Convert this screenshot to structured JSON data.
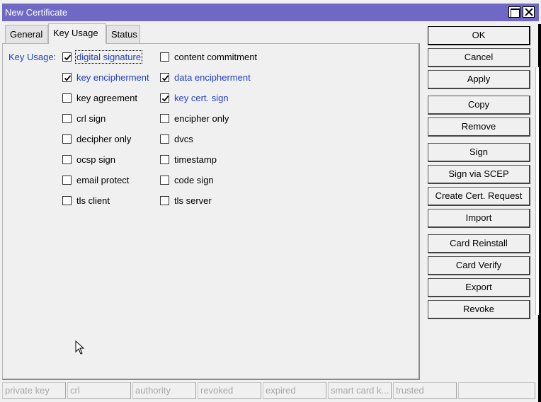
{
  "window": {
    "title": "New Certificate"
  },
  "tabs": [
    {
      "label": "General",
      "active": false
    },
    {
      "label": "Key Usage",
      "active": true
    },
    {
      "label": "Status",
      "active": false
    }
  ],
  "key_usage": {
    "label": "Key Usage:",
    "options": [
      {
        "label": "digital signature",
        "checked": true,
        "focused": true
      },
      {
        "label": "content commitment",
        "checked": false
      },
      {
        "label": "key encipherment",
        "checked": true
      },
      {
        "label": "data encipherment",
        "checked": true
      },
      {
        "label": "key agreement",
        "checked": false
      },
      {
        "label": "key cert. sign",
        "checked": true
      },
      {
        "label": "crl sign",
        "checked": false
      },
      {
        "label": "encipher only",
        "checked": false
      },
      {
        "label": "decipher only",
        "checked": false
      },
      {
        "label": "dvcs",
        "checked": false
      },
      {
        "label": "ocsp sign",
        "checked": false
      },
      {
        "label": "timestamp",
        "checked": false
      },
      {
        "label": "email protect",
        "checked": false
      },
      {
        "label": "code sign",
        "checked": false
      },
      {
        "label": "tls client",
        "checked": false
      },
      {
        "label": "tls server",
        "checked": false
      }
    ]
  },
  "buttons": [
    "OK",
    "Cancel",
    "Apply",
    "Copy",
    "Remove",
    "Sign",
    "Sign via SCEP",
    "Create Cert. Request",
    "Import",
    "Card Reinstall",
    "Card Verify",
    "Export",
    "Revoke"
  ],
  "status_bar": [
    "private key",
    "crl",
    "authority",
    "revoked",
    "expired",
    "smart card k...",
    "trusted",
    ""
  ],
  "colors": {
    "title_bar": "#6f68c4",
    "checked_label": "#1e3ec8",
    "status_text": "#a8a8a8"
  },
  "icons": {
    "maximize": "maximize-icon",
    "close": "close-icon",
    "cursor": "mouse-pointer-icon"
  }
}
